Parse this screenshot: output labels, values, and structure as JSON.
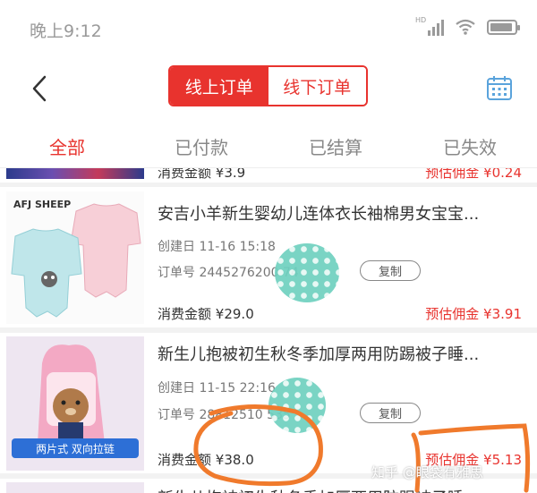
{
  "status": {
    "time": "晚上9:12",
    "network": "HD"
  },
  "header": {
    "tabs": [
      "线上订单",
      "线下订单"
    ],
    "active_tab": 0
  },
  "filter_tabs": {
    "items": [
      "全部",
      "已付款",
      "已结算",
      "已失效"
    ],
    "active": 0
  },
  "orders": [
    {
      "amount_label": "消费金额",
      "amount": "¥3.9",
      "commission_label": "预估佣金",
      "commission": "¥0.24"
    },
    {
      "title": "安吉小羊新生婴幼儿连体衣长袖棉男女宝宝...",
      "created_label": "创建日",
      "created": "11-16 15:18",
      "order_label": "订单号",
      "order_no": "2445276200  74",
      "copy_label": "复制",
      "amount_label": "消费金额",
      "amount": "¥29.0",
      "commission_label": "预估佣金",
      "commission": "¥3.91",
      "brand": "AFJ SHEEP"
    },
    {
      "title": "新生儿抱被初生秋冬季加厚两用防踢被子睡...",
      "created_label": "创建日",
      "created": "11-15 22:16",
      "order_label": "订单号",
      "order_no": "28812510  535",
      "copy_label": "复制",
      "amount_label": "消费金额",
      "amount": "¥38.0",
      "commission_label": "预估佣金",
      "commission": "¥5.13",
      "badge": "两片式 双向拉链"
    },
    {
      "title": "新生儿抱被初生秋冬季加厚两用防踢被子睡..."
    }
  ],
  "watermark": "知乎 @眼袋有雅思",
  "colors": {
    "accent": "#e8332e",
    "annotation": "#f07a2c",
    "spot": "#6fd1c0"
  }
}
